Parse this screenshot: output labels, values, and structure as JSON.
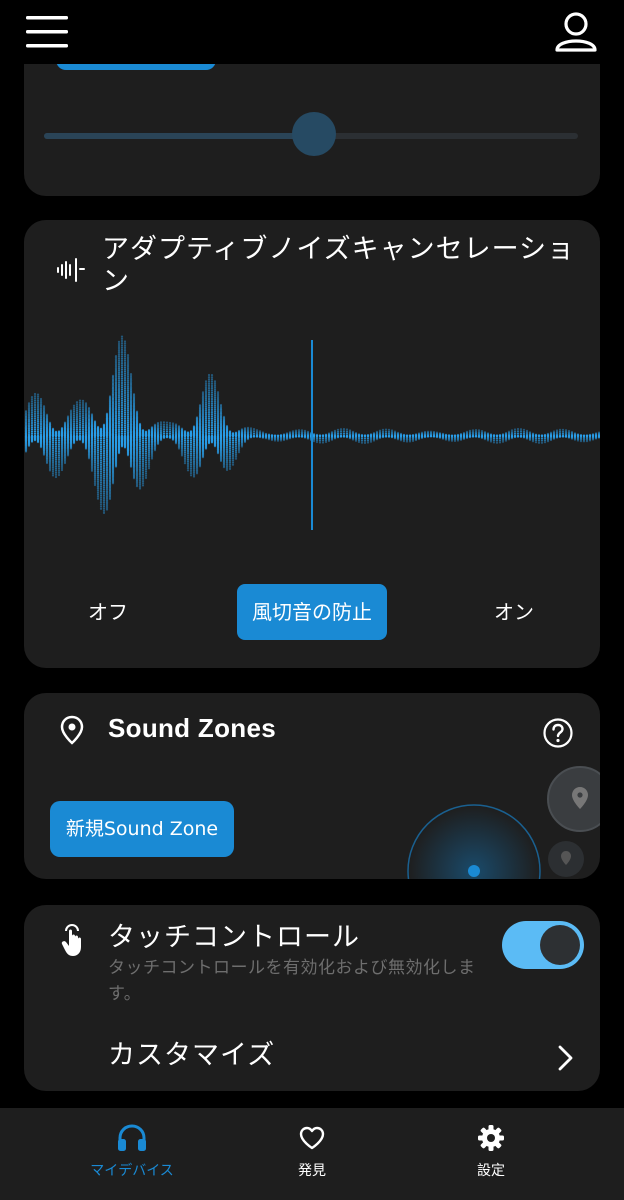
{
  "anc": {
    "title": "アダプティブノイズキャンセレーション",
    "modes": {
      "off": "オフ",
      "wind": "風切音の防止",
      "on": "オン"
    },
    "selected_mode": "wind"
  },
  "sound_zones": {
    "title": "Sound Zones",
    "new_zone_label": "新規Sound Zone"
  },
  "touch_control": {
    "title": "タッチコントロール",
    "subtitle": "タッチコントロールを有効化および無効化します。",
    "enabled": true,
    "customize_label": "カスタマイズ"
  },
  "tabs": [
    {
      "label": "マイデバイス",
      "icon": "headphones-icon",
      "active": true
    },
    {
      "label": "発見",
      "icon": "heart-icon",
      "active": false
    },
    {
      "label": "設定",
      "icon": "gear-icon",
      "active": false
    }
  ],
  "colors": {
    "accent": "#1a8ad4",
    "toggle_on": "#5bbbf5",
    "card_bg": "#1e1e1e"
  }
}
